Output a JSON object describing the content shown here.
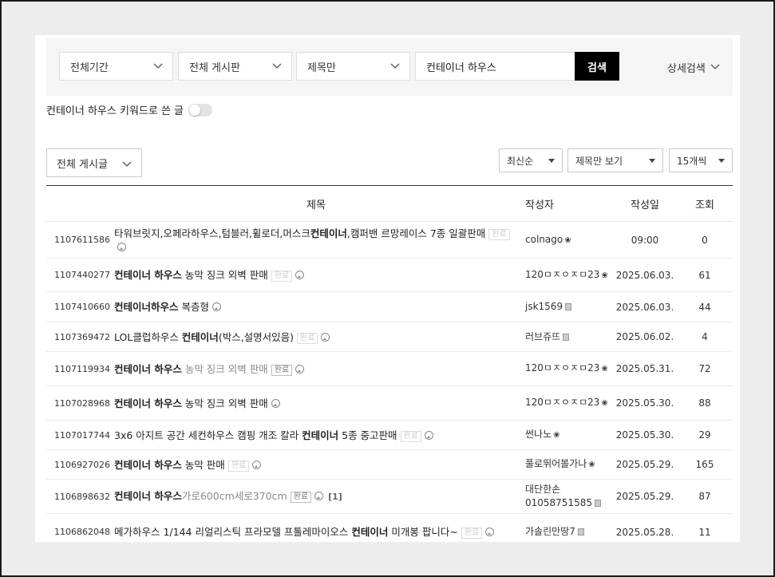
{
  "search": {
    "period": "전체기간",
    "board": "전체 게시판",
    "field": "제목만",
    "query": "컨테이너 하우스",
    "button": "검색",
    "detail": "상세검색"
  },
  "keyword_filter": {
    "label": "컨테이너 하우스 키워드로 쓴 글",
    "on": false
  },
  "list_filter": "전체 게시글",
  "sort": "최신순",
  "view": "제목만 보기",
  "per_page": "15개씩",
  "columns": {
    "title": "제목",
    "author": "작성자",
    "date": "작성일",
    "views": "조회"
  },
  "posts": [
    {
      "id": "1107611586",
      "title_parts": [
        "타워브릿지,오페라하우스,텀블러,휠로더,머스크",
        "컨테이너",
        ",캠퍼밴 르망레이스 7종 일괄판매"
      ],
      "badge": "완료",
      "badge_style": "faint",
      "photo": true,
      "comments": "",
      "author": "colnago",
      "author_icon": "sprout",
      "date": "09:00",
      "views": "0"
    },
    {
      "id": "1107440277",
      "title_parts": [
        "",
        "컨테이너 하우스",
        " 농막 징크 외벽 판매"
      ],
      "badge": "완료",
      "badge_style": "faint",
      "photo": true,
      "comments": "",
      "author": "120ㅁㅈㅇㅈㅁ23",
      "author_icon": "sprout",
      "date": "2025.06.03.",
      "views": "61"
    },
    {
      "id": "1107410660",
      "title_parts": [
        "",
        "컨테이너하우스",
        " 복층형"
      ],
      "badge": "",
      "badge_style": "",
      "photo": true,
      "comments": "",
      "author": "jsk1569",
      "author_icon": "level",
      "date": "2025.06.03.",
      "views": "44"
    },
    {
      "id": "1107369472",
      "title_parts": [
        "LOL클럽하우스 ",
        "컨테이너",
        "(박스,설명서있음)"
      ],
      "badge": "완료",
      "badge_style": "faint",
      "photo": true,
      "comments": "",
      "author": "러브쥬뜨",
      "author_icon": "level",
      "date": "2025.06.02.",
      "views": "4"
    },
    {
      "id": "1107119934",
      "title_parts": [
        "",
        "컨테이너 하우스",
        " 농막 징크 외벽 판매"
      ],
      "badge": "완료",
      "badge_style": "normal",
      "photo": true,
      "comments": "",
      "muted_tail": true,
      "author": "120ㅁㅈㅇㅈㅁ23",
      "author_icon": "sprout",
      "date": "2025.05.31.",
      "views": "72"
    },
    {
      "id": "1107028968",
      "title_parts": [
        "",
        "컨테이너 하우스",
        " 농막 징크 외벽 판매"
      ],
      "badge": "",
      "badge_style": "",
      "photo": true,
      "comments": "",
      "author": "120ㅁㅈㅇㅈㅁ23",
      "author_icon": "sprout",
      "date": "2025.05.30.",
      "views": "88"
    },
    {
      "id": "1107017744",
      "title_parts": [
        "3x6 아지트 공간 세컨하우스 캠핑 개조 칼라 ",
        "컨테이너",
        " 5종 중고판매"
      ],
      "badge": "완료",
      "badge_style": "faint",
      "photo": true,
      "comments": "",
      "author": "썬나노",
      "author_icon": "sprout",
      "date": "2025.05.30.",
      "views": "29"
    },
    {
      "id": "1106927026",
      "title_parts": [
        "",
        "컨테이너 하우스",
        " 농막 판매"
      ],
      "badge": "완료",
      "badge_style": "faint",
      "photo": true,
      "comments": "",
      "author": "풀로뛰어볼가나",
      "author_icon": "sprout",
      "date": "2025.05.29.",
      "views": "165"
    },
    {
      "id": "1106898632",
      "title_parts": [
        "",
        "컨테이너 하우스",
        "가로600cm세로370cm"
      ],
      "badge": "완료",
      "badge_style": "normal",
      "photo": true,
      "comments": "[1]",
      "muted_tail": true,
      "author": "대단한손 01058751585",
      "author_icon": "level",
      "date": "2025.05.29.",
      "views": "87"
    },
    {
      "id": "1106862048",
      "title_parts": [
        "메가하우스 1/144 리얼리스틱 프라모델 프톨레마이오스 ",
        "컨테이너",
        " 미개봉 팝니다~"
      ],
      "badge": "완료",
      "badge_style": "faint",
      "photo": true,
      "comments": "",
      "author": "가솔린만땅7",
      "author_icon": "level",
      "date": "2025.05.28.",
      "views": "11"
    }
  ]
}
